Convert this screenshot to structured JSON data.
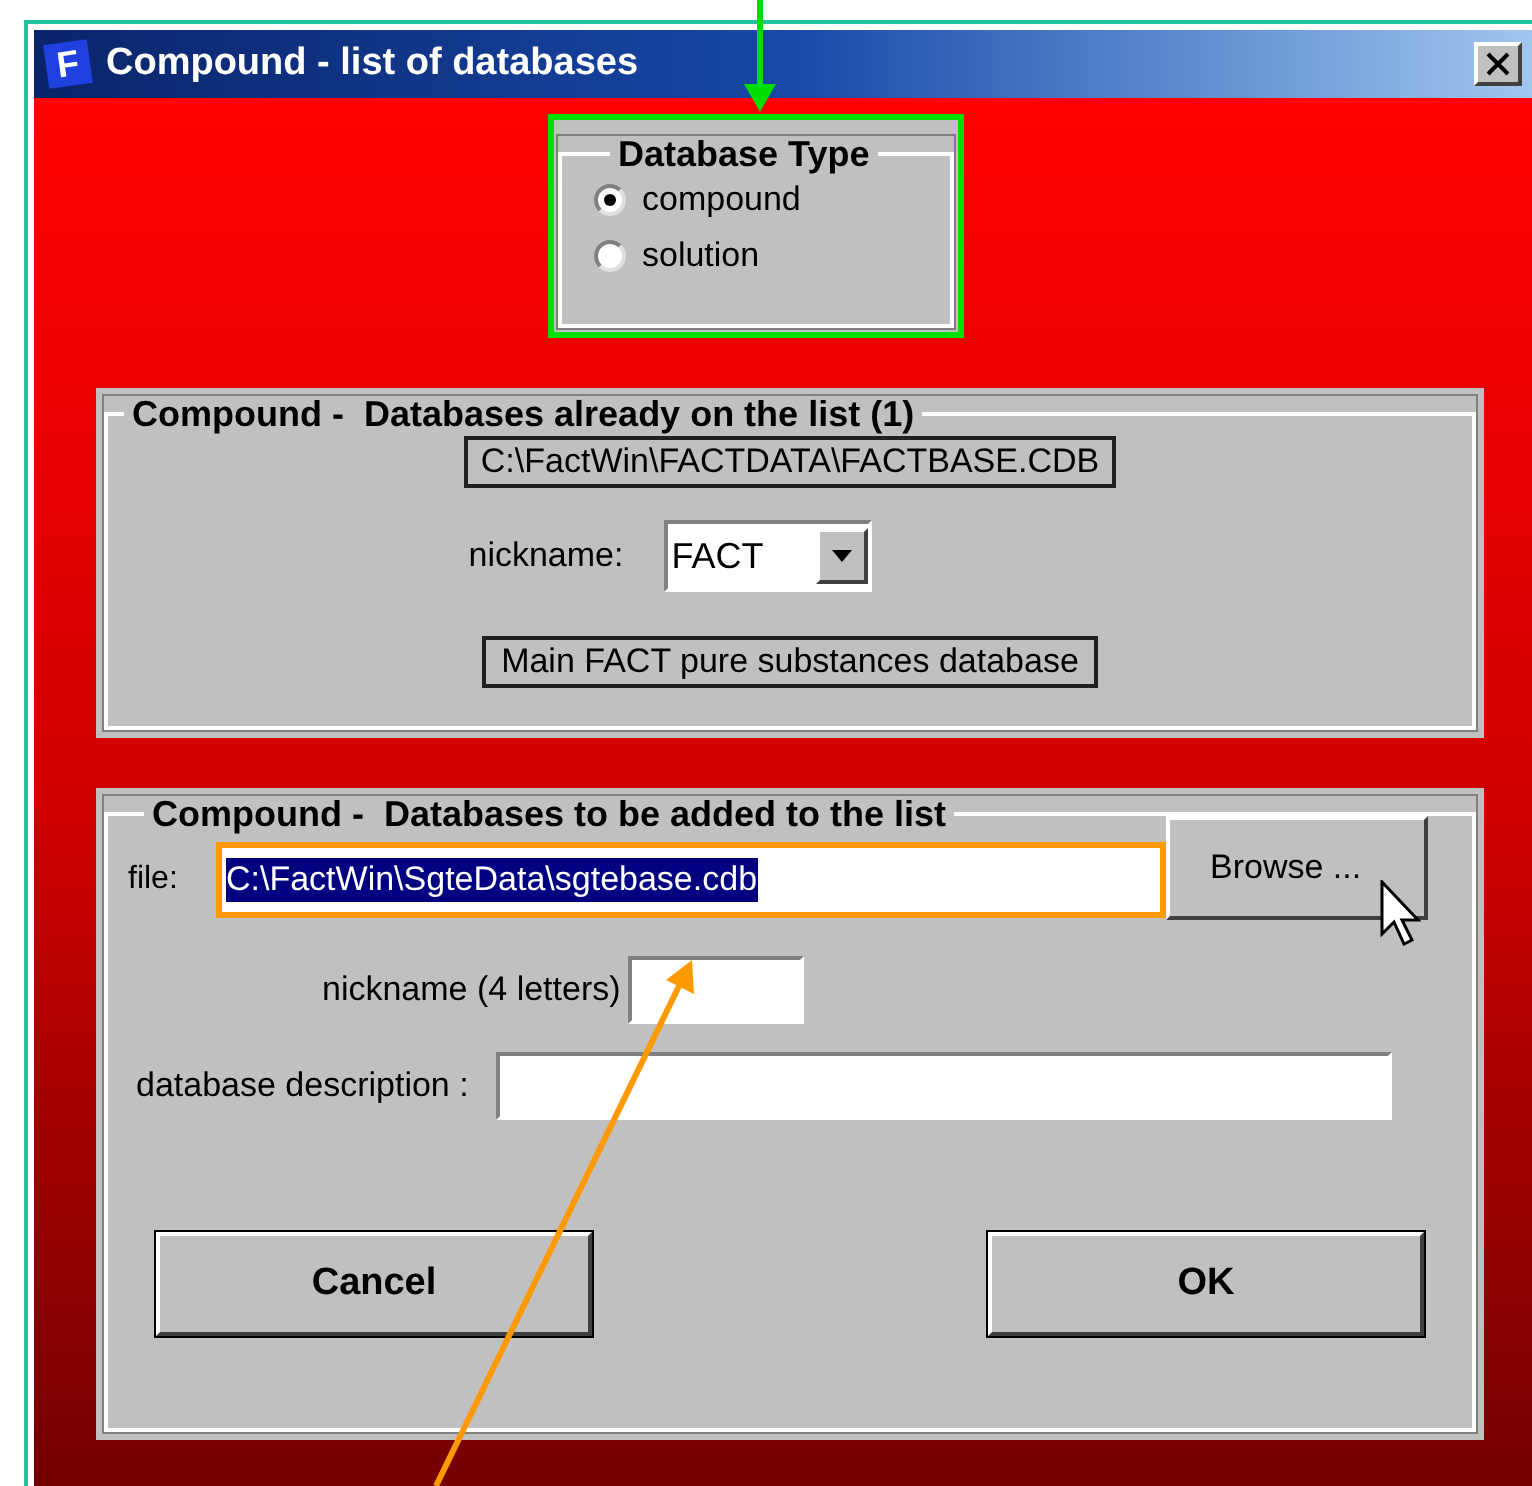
{
  "window": {
    "icon_letter": "F",
    "title": "Compound - list of databases"
  },
  "database_type": {
    "title": "Database Type",
    "options": [
      {
        "label": "compound",
        "selected": true
      },
      {
        "label": "solution",
        "selected": false
      }
    ]
  },
  "existing": {
    "title": "Compound -  Databases already on the list (1)",
    "path": "C:\\FactWin\\FACTDATA\\FACTBASE.CDB",
    "nickname_label": "nickname:",
    "nickname_value": "FACT",
    "description": "Main FACT pure substances database"
  },
  "to_add": {
    "title": "Compound -  Databases to be added to the list",
    "file_label": "file:",
    "file_value": "C:\\FactWin\\SgteData\\sgtebase.cdb",
    "file_text_selected": true,
    "browse": "Browse ...",
    "nickname_label": "nickname (4 letters)",
    "description_label": "database description :"
  },
  "buttons": [
    {
      "label": "Cancel"
    },
    {
      "label": "OK"
    }
  ]
}
